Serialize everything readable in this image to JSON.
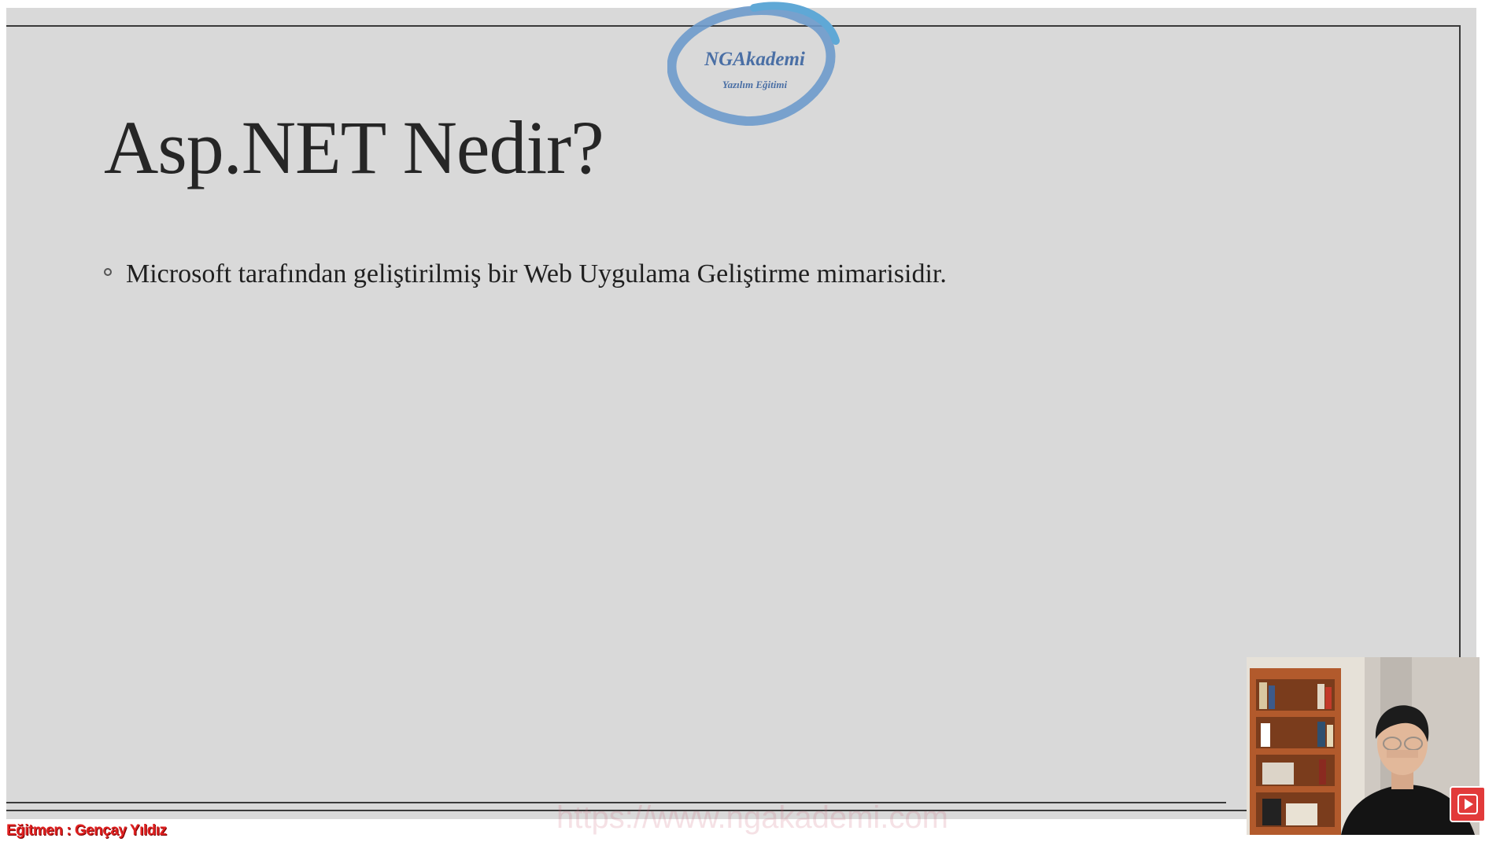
{
  "slide": {
    "title": "Asp.NET Nedir?",
    "bullets": [
      "Microsoft tarafından geliştirilmiş bir Web Uygulama Geliştirme mimarisidir."
    ]
  },
  "logo": {
    "main_text": "NGAkademi",
    "sub_text": "Yazılım Eğitimi"
  },
  "overlay": {
    "website_watermark": "https://www.ngakademi.com",
    "instructor_label": "Eğitmen : Gençay Yıldız"
  },
  "colors": {
    "slide_background": "#d9d9d9",
    "logo_blue": "#4a6fa5",
    "instructor_red": "#e02020",
    "play_badge_red": "#e23a3a"
  },
  "icons": {
    "play_badge": "play-icon"
  }
}
